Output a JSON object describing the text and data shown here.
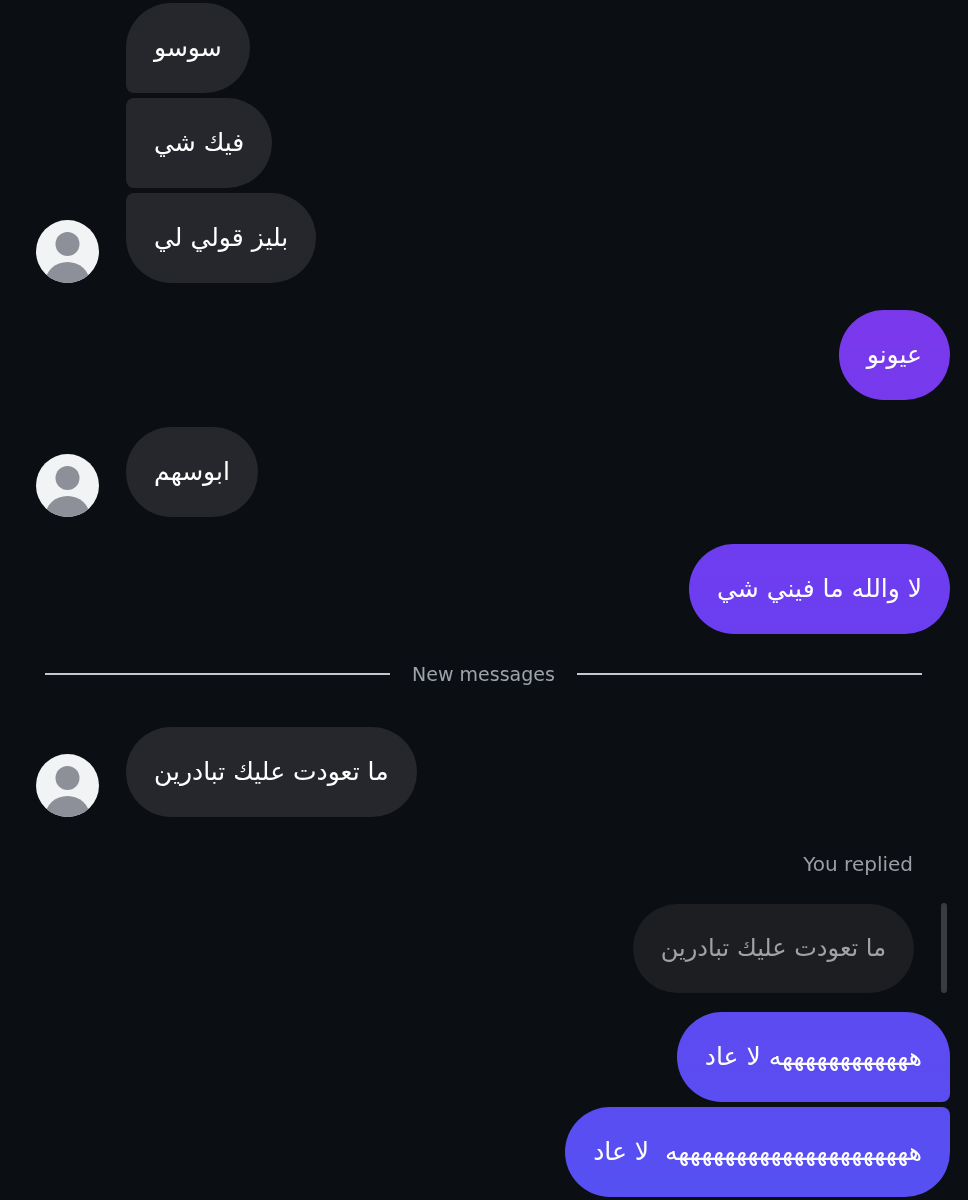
{
  "thread": [
    {
      "kind": "incoming",
      "text": "سوسو",
      "avatar": false,
      "joined_above": false,
      "joined_below": true
    },
    {
      "kind": "incoming",
      "text": "فيك شي",
      "avatar": false,
      "joined_above": true,
      "joined_below": true
    },
    {
      "kind": "incoming",
      "text": "بليز قولي لي",
      "avatar": true,
      "joined_above": true,
      "joined_below": false
    },
    {
      "kind": "outgoing",
      "text": "عيونو",
      "joined_above": false,
      "joined_below": false
    },
    {
      "kind": "incoming",
      "text": "ابوسهم",
      "avatar": true,
      "joined_above": false,
      "joined_below": false
    },
    {
      "kind": "outgoing",
      "text": "لا والله ما فيني شي",
      "joined_above": false,
      "joined_below": false
    },
    {
      "kind": "divider",
      "label": "New messages"
    },
    {
      "kind": "incoming",
      "text": "ما تعودت عليك تبادرين",
      "avatar": true,
      "joined_above": false,
      "joined_below": false
    },
    {
      "kind": "outgoing",
      "reply": {
        "label": "You replied",
        "quote": "ما تعودت عليك تبادرين"
      },
      "text": "ههههههههههههه لا عاد",
      "joined_above": false,
      "joined_below": true
    },
    {
      "kind": "outgoing",
      "text": "هههههههههههههههههههههه  لا عاد",
      "joined_above": true,
      "joined_below": false
    }
  ]
}
